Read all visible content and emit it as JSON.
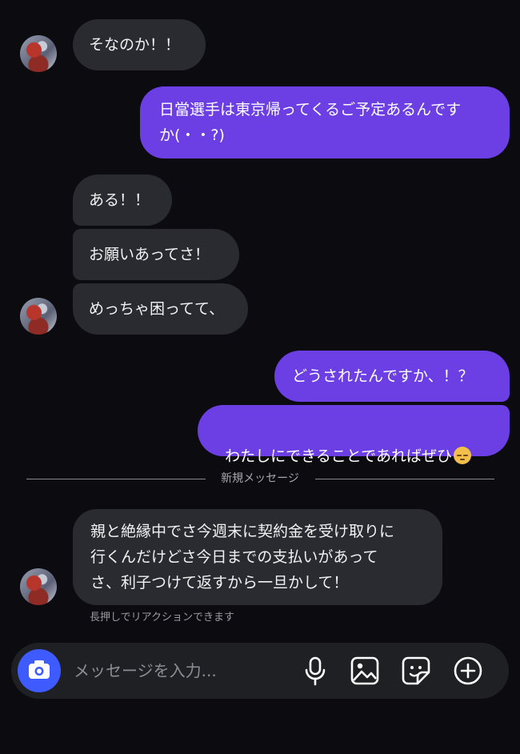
{
  "messages": [
    {
      "text": "そなのか！！"
    },
    {
      "text": "日當選手は東京帰ってくるご予定あるんです\nか(・・?)"
    },
    {
      "text": "ある！！"
    },
    {
      "text": "お願いあってさ！"
    },
    {
      "text": "めっちゃ困ってて、"
    },
    {
      "text": "どうされたんですか、！？"
    },
    {
      "text": "わたしにできることであればぜひ",
      "emoji_icon": "pensive-face-emoji"
    },
    {
      "text": "親と絶縁中でさ今週末に契約金を受け取りに\n行くんだけどさ今日までの支払いがあって\nさ、利子つけて返すから一旦かして！"
    }
  ],
  "divider": {
    "label": "新規メッセージ"
  },
  "reaction_hint": "長押しでリアクションできます",
  "composer": {
    "placeholder": "メッセージを入力...",
    "icons": [
      "camera-icon",
      "microphone-icon",
      "image-icon",
      "sticker-icon",
      "plus-circle-icon"
    ]
  },
  "colors": {
    "background": "#0b0b10",
    "incoming_bubble": "#2a2b30",
    "outgoing_bubble": "#6b3fe4",
    "camera_button": "#3d5bff"
  }
}
